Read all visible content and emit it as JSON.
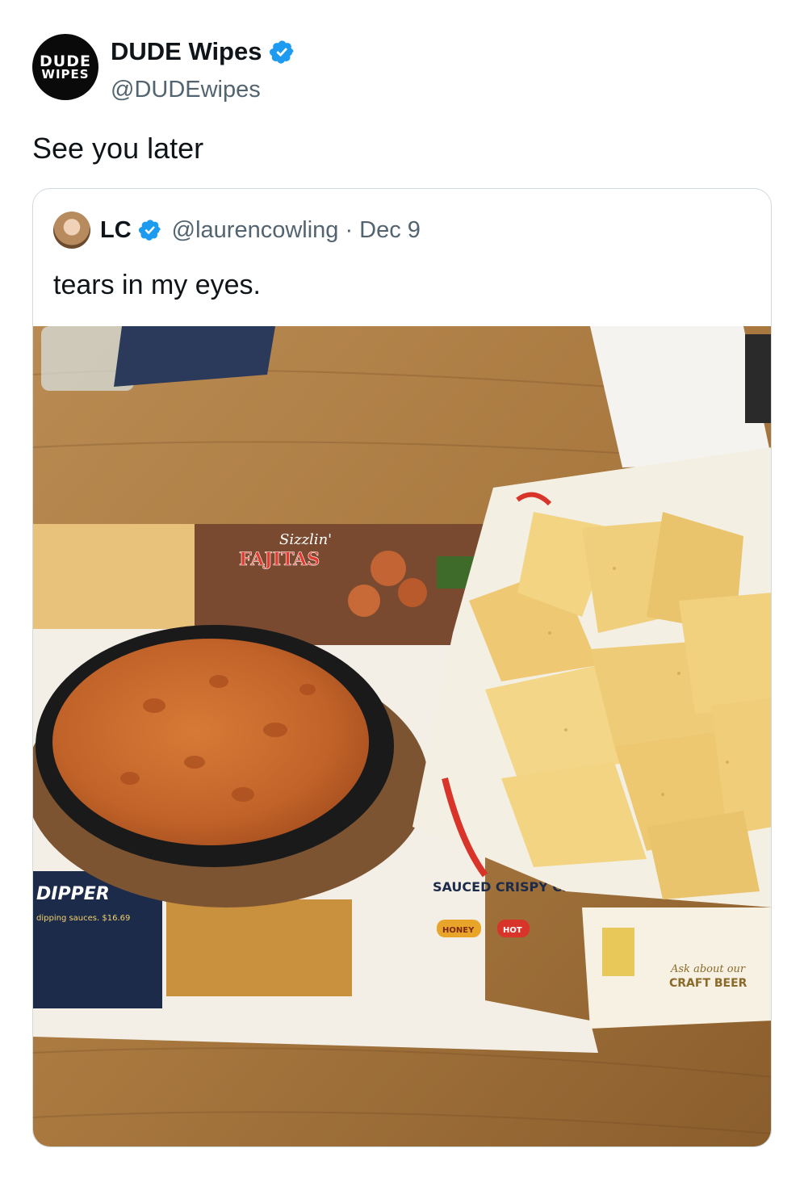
{
  "post": {
    "author": {
      "display_name": "DUDE Wipes",
      "handle": "@DUDEwipes",
      "avatar_text_line1": "DUDE",
      "avatar_text_line2": "WIPES",
      "verified_icon": "verified-badge-icon"
    },
    "text": "See you later"
  },
  "quoted_post": {
    "author": {
      "display_name": "LC",
      "handle": "@laurencowling",
      "verified_icon": "verified-badge-icon"
    },
    "separator": "·",
    "date": "Dec 9",
    "text": "tears in my eyes.",
    "photo": {
      "menu_text": {
        "fajitas_script": "Sizzlin'",
        "fajitas_title": "FAJITAS",
        "dipper": "DIPPER",
        "dipper_sub": "dipping sauces. $16.69",
        "sauced": "SAUCED CRISPY CRIS",
        "honey": "HONEY",
        "hot": "HOT",
        "craft_beer": "CRAFT BEER",
        "ask": "Ask about our"
      }
    }
  },
  "colors": {
    "verified_blue": "#1d9bf0",
    "secondary_text": "#536471",
    "border": "#cfd9de"
  }
}
